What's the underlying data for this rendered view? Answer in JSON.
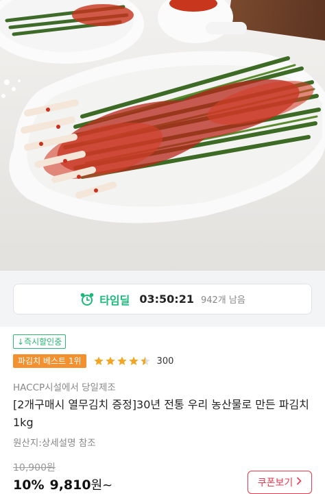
{
  "product_image": {
    "subject": "green onion kimchi on white plate"
  },
  "time_deal": {
    "label": "타임딜",
    "countdown": "03:50:21",
    "stock_left": "942개 남음",
    "icon": "alarm-clock-icon"
  },
  "badges": {
    "instant": "↓즉시할인중",
    "best": "파김치 베스트 1위"
  },
  "rating": {
    "stars": 4.5,
    "count": "300"
  },
  "origin_note": "HACCP시설에서 당일제조",
  "title": "[2개구매시 열무김치 증정]30년 전통 우리 농산물로 만든 파김치1kg",
  "origin_country": "원산지:상세설명 참조",
  "price": {
    "original": "10,900원",
    "discount": "10%",
    "current": "9,810",
    "unit": "원~"
  },
  "coupon": {
    "label": "쿠폰보기",
    "icon": "chevron-right-icon"
  },
  "colors": {
    "green": "#1bb87a",
    "orange": "#f3902f",
    "red": "#e8384f"
  }
}
